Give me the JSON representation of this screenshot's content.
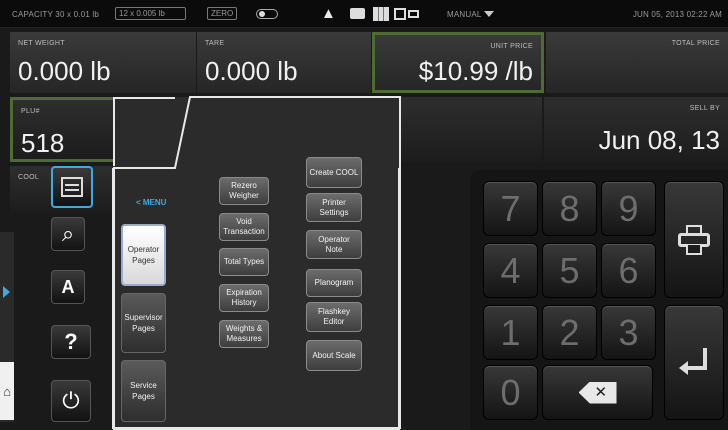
{
  "status_bar": {
    "capacity": "CAPACITY   30 x 0.01 lb",
    "capacity_alt": "12 x 0.005 lb",
    "zero": "ZERO",
    "mode": "MANUAL",
    "datetime": "JUN 05, 2013 02:22 AM"
  },
  "fields": {
    "net_weight_label": "NET WEIGHT",
    "net_weight_value": "0.000 lb",
    "tare_label": "TARE",
    "tare_value": "0.000 lb",
    "unit_price_label": "UNIT PRICE",
    "unit_price_value": "$10.99 /lb",
    "total_price_label": "TOTAL PRICE",
    "plu_label": "PLU#",
    "plu_value": "518",
    "sell_by_label": "SELL BY",
    "sell_by_value": "Jun 08, 13",
    "cool_label": "COOL"
  },
  "menu": {
    "back_label": "< MENU",
    "page_tabs": [
      "Operator Pages",
      "Supervisor Pages",
      "Service Pages"
    ],
    "col1": [
      "Rezero Weigher",
      "Void Transaction",
      "Total Types",
      "Expiration History",
      "Weights & Measures"
    ],
    "col2": [
      "Create COOL",
      "Printer Settings",
      "Operator Note",
      "Planogram",
      "Flashkey Editor",
      "About Scale"
    ]
  },
  "keypad": {
    "keys": [
      "7",
      "8",
      "9",
      "4",
      "5",
      "6",
      "1",
      "2",
      "3",
      "0"
    ]
  },
  "icons": [
    "warning-icon",
    "printer-icon",
    "grid-icon",
    "network-icon",
    "menu-list-icon",
    "search-icon",
    "language-icon",
    "help-icon",
    "power-icon",
    "home-icon",
    "backspace-icon",
    "enter-icon"
  ],
  "colors": {
    "accent_blue": "#3fa9e0",
    "field_border_green": "#4f6b35"
  }
}
